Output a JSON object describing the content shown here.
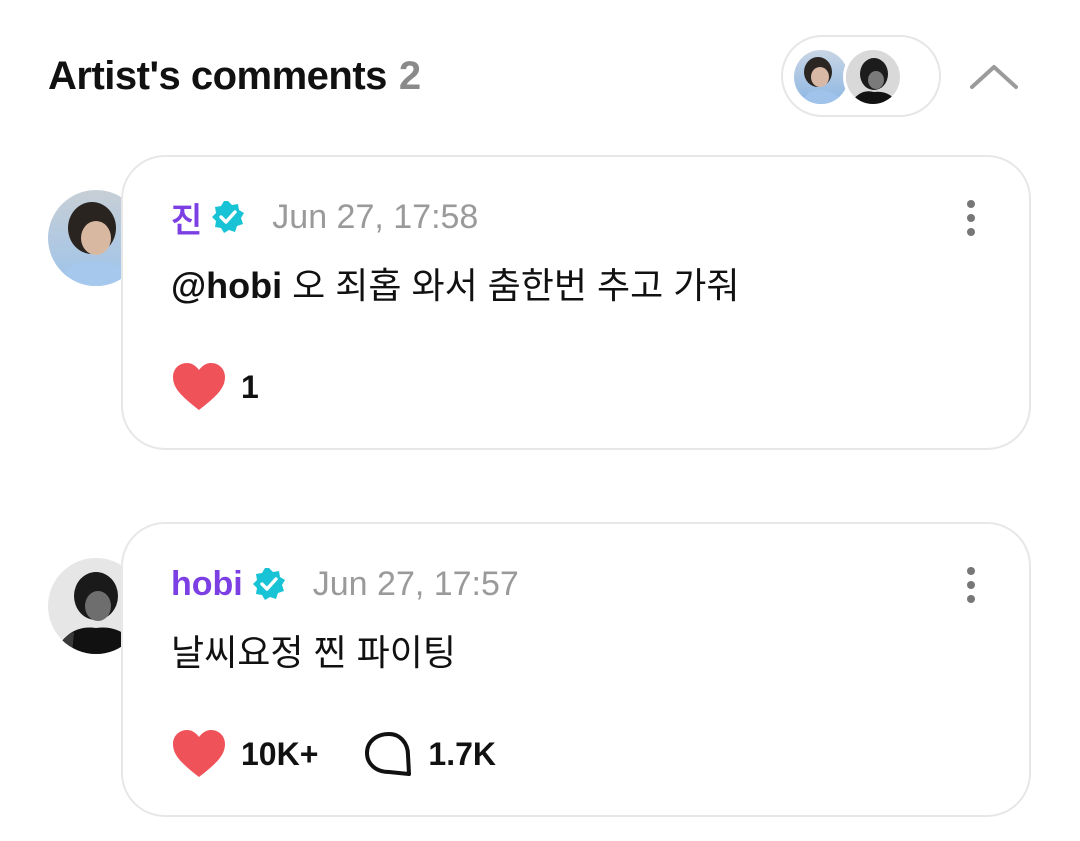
{
  "header": {
    "title": "Artist's comments",
    "count": "2"
  },
  "comments": [
    {
      "author": "진",
      "timestamp": "Jun 27, 17:58",
      "mention": "@hobi",
      "text": " 오 죄홉 와서 춤한번 추고 가줘",
      "likes": "1"
    },
    {
      "author": "hobi",
      "timestamp": "Jun 27, 17:57",
      "mention": "",
      "text": "날씨요정 찐 파이팅",
      "likes": "10K+",
      "replies": "1.7K"
    }
  ],
  "colors": {
    "author_name": "#7b3fe4",
    "verified_badge": "#19c3d6",
    "heart": "#f0525a",
    "timestamp": "#9a9a9a"
  },
  "icons": {
    "verified": "verified-badge-icon",
    "more": "more-vertical-icon",
    "like": "heart-icon",
    "reply": "comment-bubble-icon",
    "collapse": "chevron-up-icon"
  }
}
